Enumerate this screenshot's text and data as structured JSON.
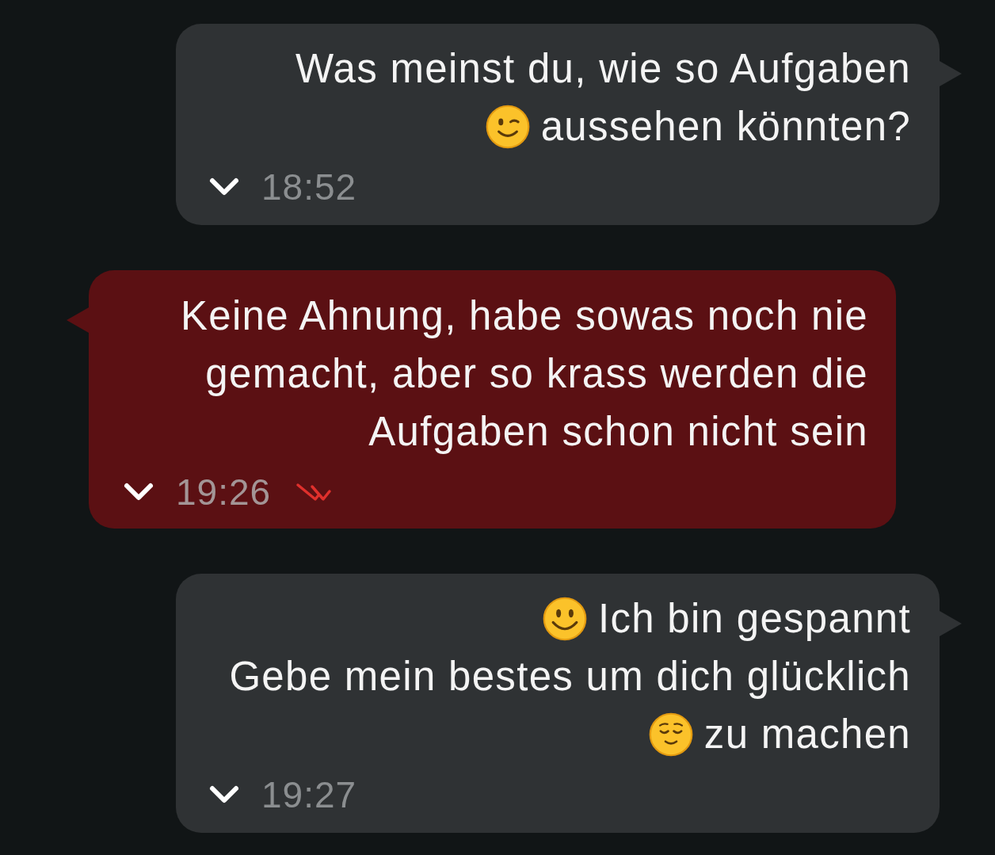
{
  "messages": [
    {
      "outgoing": false,
      "parts": [
        {
          "kind": "plain",
          "text": "Was meinst du, wie so Aufgaben"
        },
        {
          "kind": "wink",
          "text": "aussehen könnten?"
        }
      ],
      "time": "18:52"
    },
    {
      "outgoing": true,
      "parts": [
        {
          "kind": "plain",
          "text": "Keine Ahnung, habe sowas noch nie\ngemacht, aber so krass werden die\nAufgaben schon nicht sein"
        }
      ],
      "time": "19:26",
      "read": true
    },
    {
      "outgoing": false,
      "parts": [
        {
          "kind": "smile",
          "text": "Ich bin gespannt"
        },
        {
          "kind": "plain",
          "text": "Gebe mein bestes um dich glücklich"
        },
        {
          "kind": "relieved",
          "text": "zu machen"
        }
      ],
      "time": "19:27"
    }
  ]
}
